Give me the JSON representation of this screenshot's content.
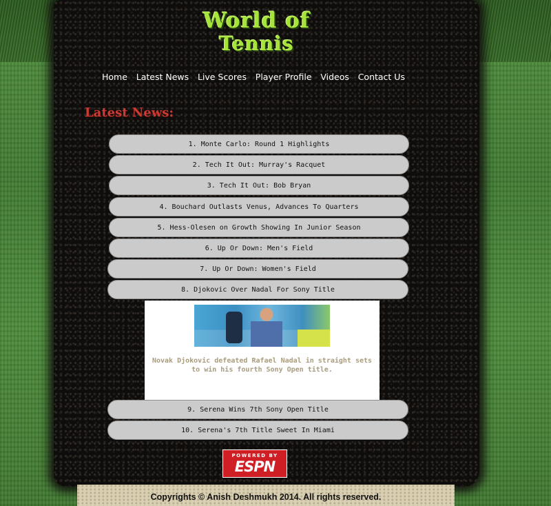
{
  "logo": {
    "line1": "World of",
    "line2": "Tennis"
  },
  "nav": [
    "Home",
    "Latest News",
    "Live Scores",
    "Player Profile",
    "Videos",
    "Contact Us"
  ],
  "section_title": "Latest News:",
  "news": [
    "1. Monte Carlo: Round 1 Highlights",
    "2. Tech It Out: Murray's Racquet",
    "3. Tech It Out: Bob Bryan",
    "4. Bouchard Outlasts Venus, Advances To Quarters",
    "5. Hess-Olesen on Growth Showing In Junior Season",
    "6. Up Or Down: Men's Field",
    "7. Up Or Down: Women's Field",
    "8. Djokovic Over Nadal For Sony Title",
    "9. Serena Wins 7th Sony Open Title",
    "10. Serena's 7th Title Sweet In Miami"
  ],
  "expanded": {
    "caption": "Novak Djokovic defeated Rafael Nadal in straight sets to win his fourth Sony Open title."
  },
  "espn": {
    "powered_by": "POWERED BY",
    "brand": "ESPN"
  },
  "footer": "Copyrights © Anish Deshmukh 2014. All rights reserved."
}
